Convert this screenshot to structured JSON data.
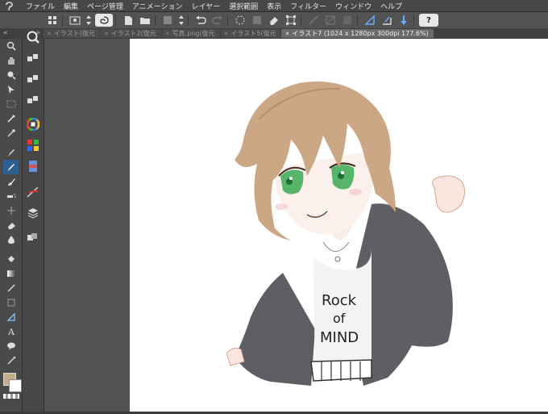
{
  "menubar": {
    "items": [
      "ファイル",
      "編集",
      "ページ管理",
      "アニメーション",
      "レイヤー",
      "選択範囲",
      "表示",
      "フィルター",
      "ウィンドウ",
      "ヘルプ"
    ]
  },
  "collapse": {
    "left": "«",
    "right": "»"
  },
  "tabs": [
    {
      "label": "イラスト(復元",
      "active": false
    },
    {
      "label": "イラスト2(復元",
      "active": false
    },
    {
      "label": "写真.png(復元",
      "active": false
    },
    {
      "label": "イラスト5(復元",
      "active": false
    },
    {
      "label": "イラスト7 (1024 x 1280px 300dpi 177.6%)",
      "active": true
    }
  ],
  "colors": {
    "main": "#c7ae8c",
    "sub": "#ffffff",
    "selected_tool": "#2e5f91"
  },
  "canvas_text": {
    "line1": "Rock",
    "line2": "of",
    "line3": "MIND"
  },
  "icons": {
    "help": "?"
  }
}
